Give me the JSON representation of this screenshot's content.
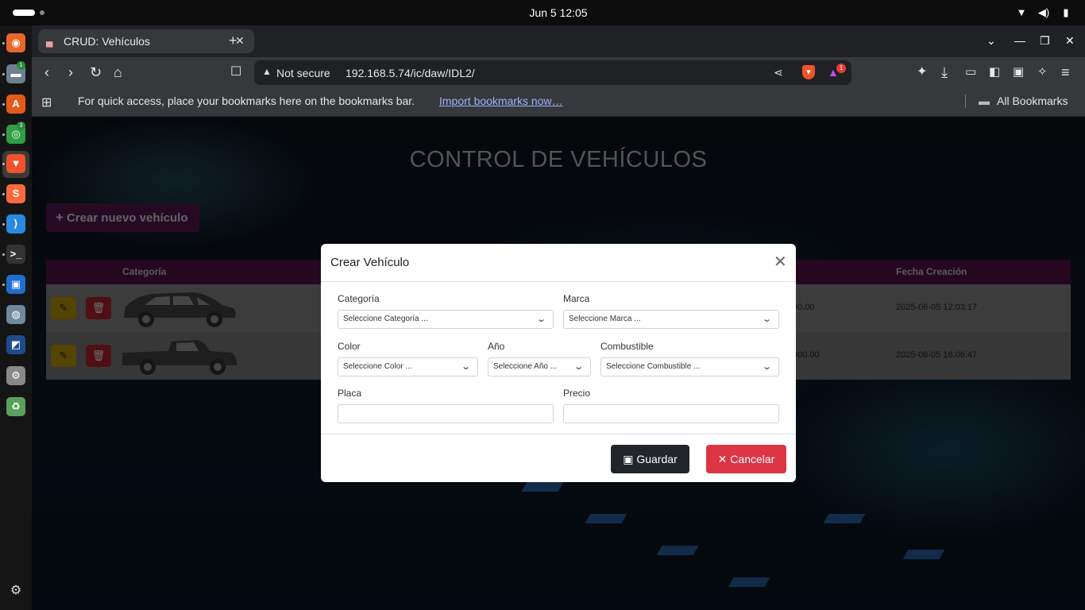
{
  "system": {
    "clock": "Jun 5  12:05",
    "icons": [
      "wifi-icon",
      "volume-icon",
      "battery-icon"
    ]
  },
  "dock": {
    "apps": [
      {
        "name": "firefox",
        "glyph": "◉",
        "color": "#e8672a"
      },
      {
        "name": "files",
        "glyph": "▬",
        "color": "#6e7f92",
        "badge": "1"
      },
      {
        "name": "app-center",
        "glyph": "A",
        "color": "#e55a1c"
      },
      {
        "name": "chrome",
        "glyph": "◎",
        "color": "#2f9e47",
        "badge": "3"
      },
      {
        "name": "brave",
        "glyph": "▼",
        "color": "#f0532b"
      },
      {
        "name": "sublime",
        "glyph": "S",
        "color": "#ff6a3d"
      },
      {
        "name": "vscode",
        "glyph": "⟩",
        "color": "#2b8ae0"
      },
      {
        "name": "terminal",
        "glyph": ">_",
        "color": "#333"
      },
      {
        "name": "remmina",
        "glyph": "▣",
        "color": "#1e6ed1"
      },
      {
        "name": "disk",
        "glyph": "◍",
        "color": "#6e8a9c"
      },
      {
        "name": "packet-tracer",
        "glyph": "◩",
        "color": "#1e4c8a"
      },
      {
        "name": "settings",
        "glyph": "⚙",
        "color": "#888"
      },
      {
        "name": "trash",
        "glyph": "♻",
        "color": "#5aa05a"
      }
    ],
    "show_apps_icon": "grid-icon"
  },
  "browser": {
    "tab_title": "CRUD: Vehículos",
    "security_label": "Not secure",
    "url": "192.168.5.74/ic/daw/IDL2/",
    "rewards_badge": "1",
    "bookmarks_prompt": "For quick access, place your bookmarks here on the bookmarks bar.",
    "bookmarks_import": "Import bookmarks now…",
    "all_bookmarks": "All Bookmarks"
  },
  "page": {
    "title": "CONTROL DE VEHÍCULOS",
    "create_button": "Crear nuevo vehículo",
    "table": {
      "headers": {
        "category": "Categoría",
        "created": "Fecha Creación"
      },
      "rows": [
        {
          "price": "00.00",
          "created": "2025-06-05 12:03:17",
          "vehicle": "car"
        },
        {
          "price": "000.00",
          "created": "2025-06-05 16:06:47",
          "vehicle": "pickup"
        }
      ]
    },
    "colors": {
      "accent": "#6b1a63",
      "table_header": "#4a0f45",
      "edit": "#d4ad0a",
      "delete": "#c8303a"
    }
  },
  "modal": {
    "title": "Crear Vehículo",
    "fields": {
      "categoria": {
        "label": "Categoría",
        "value": "Seleccione Categoría ..."
      },
      "marca": {
        "label": "Marca",
        "value": "Seleccione Marca ..."
      },
      "color": {
        "label": "Color",
        "value": "Seleccione Color ..."
      },
      "anio": {
        "label": "Año",
        "value": "Seleccione Año ..."
      },
      "combustible": {
        "label": "Combustible",
        "value": "Seleccione Combustible ..."
      },
      "placa": {
        "label": "Placa",
        "value": ""
      },
      "precio": {
        "label": "Precio",
        "value": ""
      }
    },
    "save_label": "Guardar",
    "cancel_label": "Cancelar",
    "colors": {
      "save": "#212529",
      "cancel": "#dc3545"
    }
  }
}
